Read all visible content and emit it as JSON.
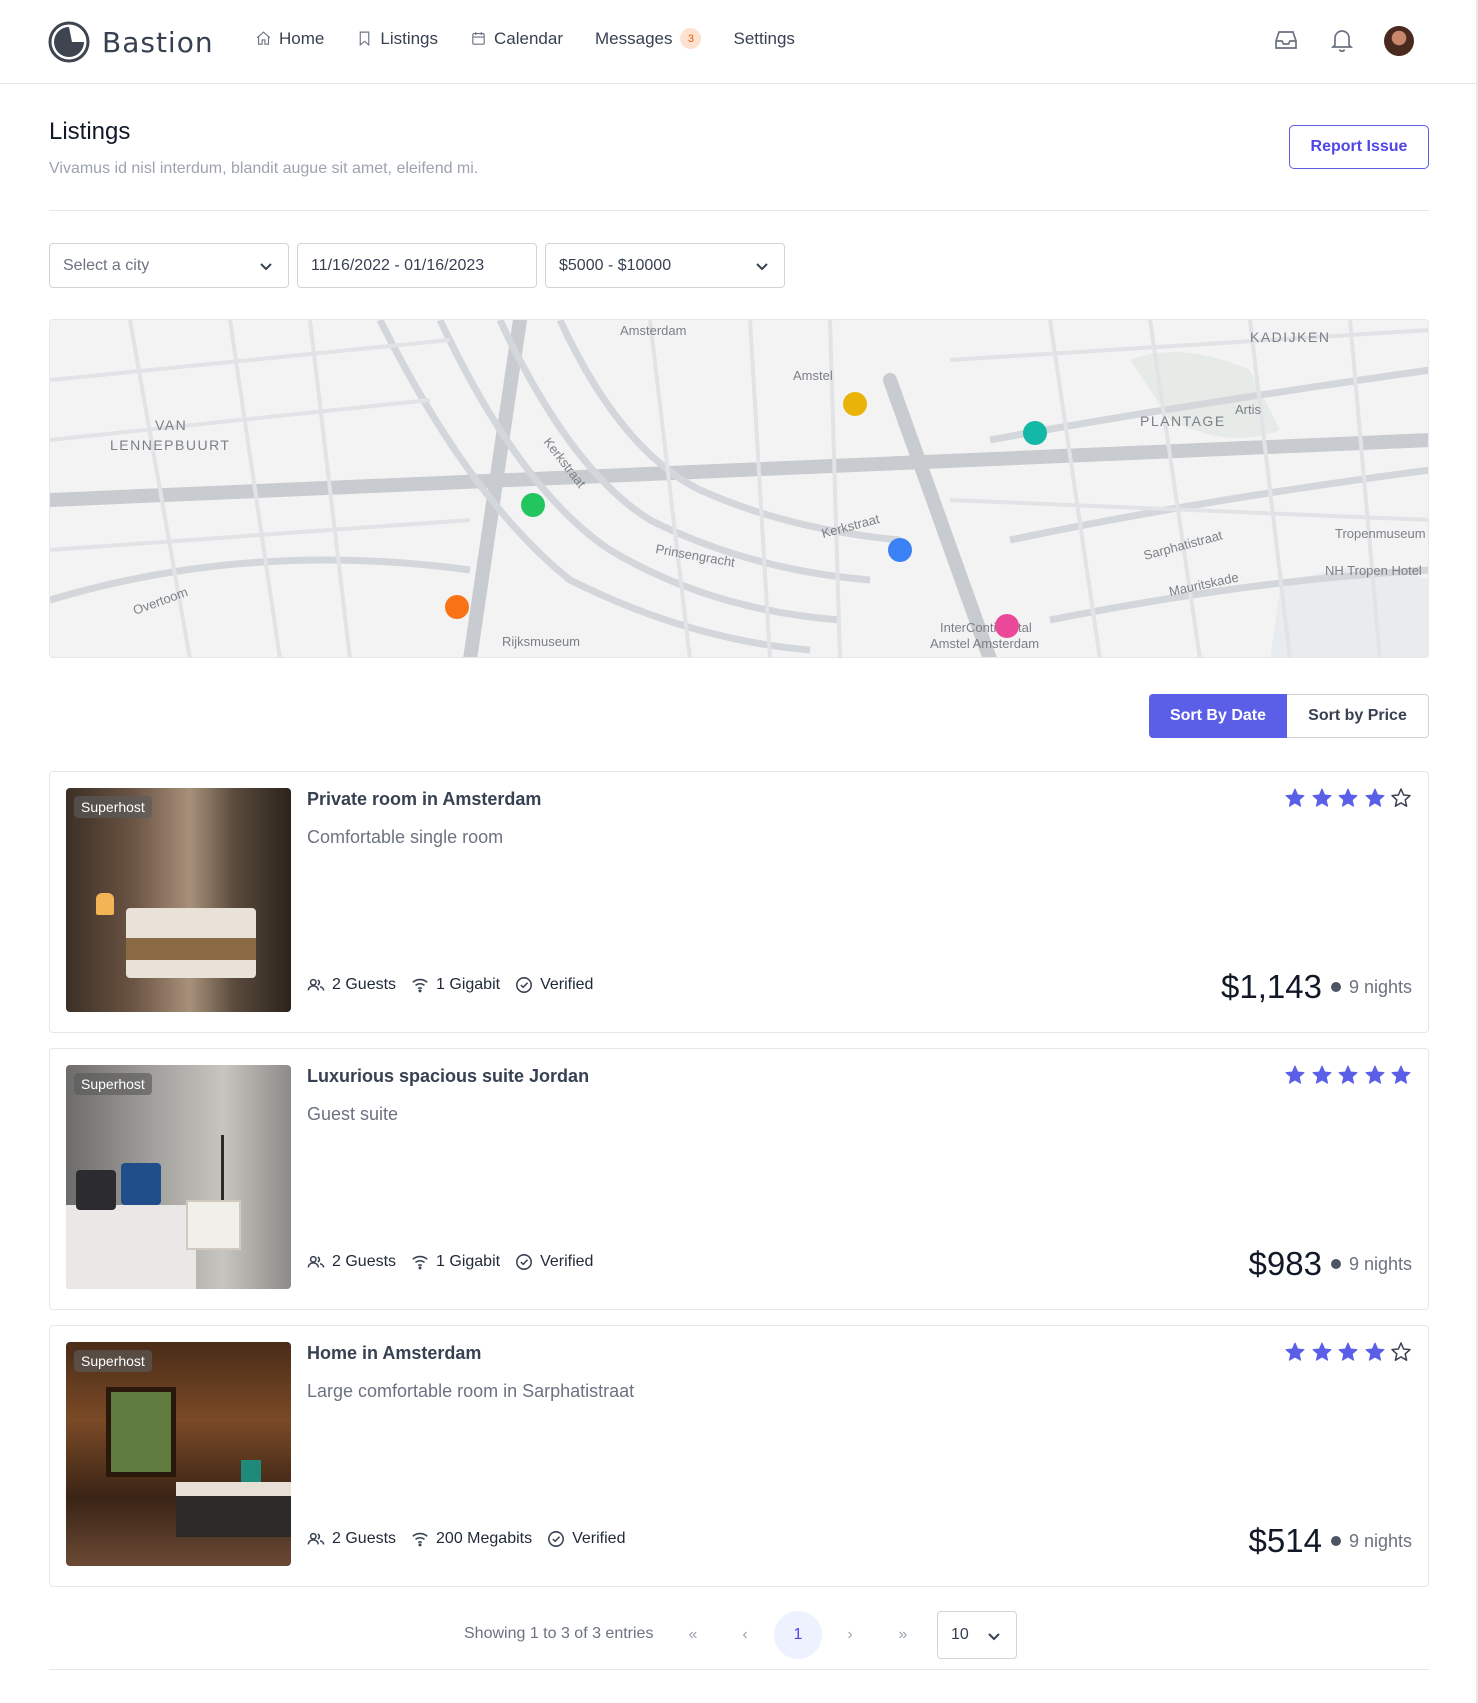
{
  "app": {
    "name": "Bastion"
  },
  "nav": [
    {
      "label": "Home",
      "icon": "home-icon"
    },
    {
      "label": "Listings",
      "icon": "bookmark-icon"
    },
    {
      "label": "Calendar",
      "icon": "calendar-icon"
    },
    {
      "label": "Messages",
      "icon": "",
      "badge": "3"
    },
    {
      "label": "Settings",
      "icon": ""
    }
  ],
  "header_icons": [
    "inbox-icon",
    "bell-icon",
    "avatar"
  ],
  "page": {
    "title": "Listings",
    "subtitle": "Vivamus id nisl interdum, blandit augue sit amet, eleifend mi.",
    "report_label": "Report Issue"
  },
  "filters": {
    "city_placeholder": "Select a city",
    "date_range": "11/16/2022 - 01/16/2023",
    "price_range": "$5000 - $10000"
  },
  "map": {
    "labels": [
      "Amsterdam",
      "Amstel",
      "KADIJKEN",
      "VAN",
      "LENNEPBUURT",
      "PLANTAGE",
      "Artis",
      "Kerkstraat",
      "Kerkstraat",
      "Prinsengracht",
      "Sarphatistraat",
      "Tropenmuseum",
      "NH Tropen Hotel",
      "Mauritskade",
      "Overtoom",
      "Rijksmuseum",
      "InterContinental",
      "Amstel Amsterdam"
    ],
    "markers": [
      {
        "color": "#eab308"
      },
      {
        "color": "#14b8a6"
      },
      {
        "color": "#22c55e"
      },
      {
        "color": "#3b82f6"
      },
      {
        "color": "#f97316"
      },
      {
        "color": "#ec4899"
      }
    ]
  },
  "sort": {
    "by_date": "Sort By Date",
    "by_price": "Sort by Price",
    "active": "date"
  },
  "accent_color": "#5b5fe8",
  "listings": [
    {
      "badge": "Superhost",
      "title": "Private room in Amsterdam",
      "subtitle": "Comfortable single room",
      "rating": 4,
      "guests": "2 Guests",
      "wifi": "1 Gigabit",
      "verified": "Verified",
      "price": "$1,143",
      "nights": "9 nights"
    },
    {
      "badge": "Superhost",
      "title": "Luxurious spacious suite Jordan",
      "subtitle": "Guest suite",
      "rating": 5,
      "guests": "2 Guests",
      "wifi": "1 Gigabit",
      "verified": "Verified",
      "price": "$983",
      "nights": "9 nights"
    },
    {
      "badge": "Superhost",
      "title": "Home in Amsterdam",
      "subtitle": "Large comfortable room in Sarphatistraat",
      "rating": 4,
      "guests": "2 Guests",
      "wifi": "200 Megabits",
      "verified": "Verified",
      "price": "$514",
      "nights": "9 nights"
    }
  ],
  "pagination": {
    "showing": "Showing 1 to 3 of 3 entries",
    "first": "«",
    "prev": "‹",
    "current": "1",
    "next": "›",
    "last": "»",
    "per_page": "10"
  }
}
